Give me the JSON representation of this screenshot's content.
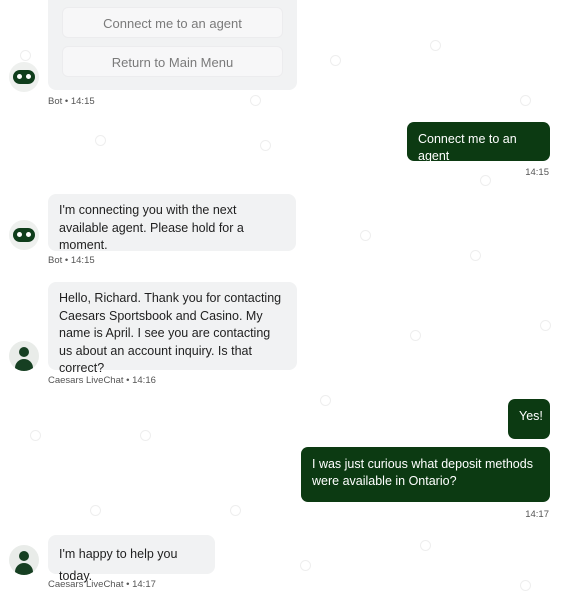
{
  "menu": {
    "options": [
      "Connect me to an agent",
      "Return to Main Menu"
    ]
  },
  "messages": [
    {
      "sender": "Bot",
      "time": "14:15",
      "meta": "Bot • 14:15"
    },
    {
      "direction": "out",
      "text": "Connect me to an agent",
      "time": "14:15"
    },
    {
      "sender": "Bot",
      "text": "I'm connecting you with the next available agent. Please hold for a moment.",
      "time": "14:15",
      "meta": "Bot • 14:15"
    },
    {
      "sender": "Caesars LiveChat",
      "text": "Hello, Richard. Thank you for contacting Caesars Sportsbook and Casino. My name is April. I see you are contacting us about an account inquiry. Is that correct?",
      "time": "14:16",
      "meta": "Caesars LiveChat • 14:16"
    },
    {
      "direction": "out",
      "text": "Yes!"
    },
    {
      "direction": "out",
      "text": "I was just curious what deposit methods were available in Ontario?",
      "time": "14:17"
    },
    {
      "sender": "Caesars LiveChat",
      "text": "I'm happy to help you today.",
      "time": "14:17",
      "meta": "Caesars LiveChat • 14:17"
    }
  ],
  "colors": {
    "outgoing_bubble": "#0c3a12",
    "incoming_bubble": "#f1f2f3",
    "avatar_dark": "#0f3d1b"
  },
  "icons": {
    "bot": "bot-icon",
    "agent": "person-icon"
  }
}
